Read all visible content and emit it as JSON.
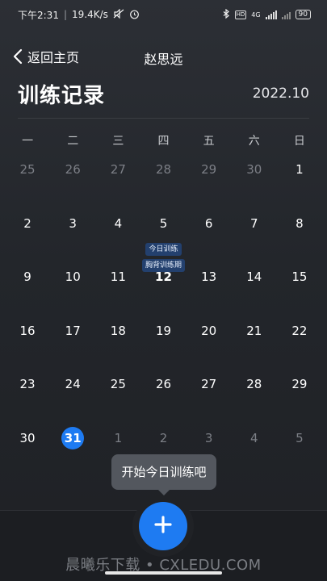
{
  "status_bar": {
    "time": "下午2:31",
    "network_speed": "19.4K/s",
    "network_type": "4G",
    "battery": "90",
    "icons": [
      "bluetooth-icon",
      "hd-icon",
      "signal-icon",
      "battery-icon",
      "alarm-icon",
      "mute-icon"
    ]
  },
  "nav": {
    "back_label": "返回主页",
    "title": "赵思远"
  },
  "header": {
    "title": "训练记录",
    "month": "2022.10"
  },
  "calendar": {
    "weekdays": [
      "一",
      "二",
      "三",
      "四",
      "五",
      "六",
      "日"
    ],
    "weeks": [
      [
        {
          "d": "25",
          "muted": true
        },
        {
          "d": "26",
          "muted": true
        },
        {
          "d": "27",
          "muted": true
        },
        {
          "d": "28",
          "muted": true
        },
        {
          "d": "29",
          "muted": true
        },
        {
          "d": "30",
          "muted": true
        },
        {
          "d": "1"
        }
      ],
      [
        {
          "d": "2"
        },
        {
          "d": "3"
        },
        {
          "d": "4"
        },
        {
          "d": "5",
          "tags": [
            "今日训练",
            "胸背训练期"
          ]
        },
        {
          "d": "6"
        },
        {
          "d": "7"
        },
        {
          "d": "8"
        }
      ],
      [
        {
          "d": "9"
        },
        {
          "d": "10"
        },
        {
          "d": "11"
        },
        {
          "d": "12",
          "bold": true
        },
        {
          "d": "13"
        },
        {
          "d": "14"
        },
        {
          "d": "15"
        }
      ],
      [
        {
          "d": "16"
        },
        {
          "d": "17"
        },
        {
          "d": "18"
        },
        {
          "d": "19"
        },
        {
          "d": "20"
        },
        {
          "d": "21"
        },
        {
          "d": "22"
        }
      ],
      [
        {
          "d": "23"
        },
        {
          "d": "24"
        },
        {
          "d": "25"
        },
        {
          "d": "26"
        },
        {
          "d": "27"
        },
        {
          "d": "28"
        },
        {
          "d": "29"
        }
      ],
      [
        {
          "d": "30"
        },
        {
          "d": "31",
          "selected": true
        },
        {
          "d": "1",
          "muted": true
        },
        {
          "d": "2",
          "muted": true
        },
        {
          "d": "3",
          "muted": true
        },
        {
          "d": "4",
          "muted": true
        },
        {
          "d": "5",
          "muted": true
        }
      ]
    ]
  },
  "tooltip": {
    "text": "开始今日训练吧"
  },
  "fab": {
    "icon": "plus-icon"
  },
  "watermark": "晨曦乐下载 • CXLEDU.COM",
  "colors": {
    "accent": "#1e7bf2",
    "background": "#26292e",
    "tag_bg": "#23406e"
  }
}
